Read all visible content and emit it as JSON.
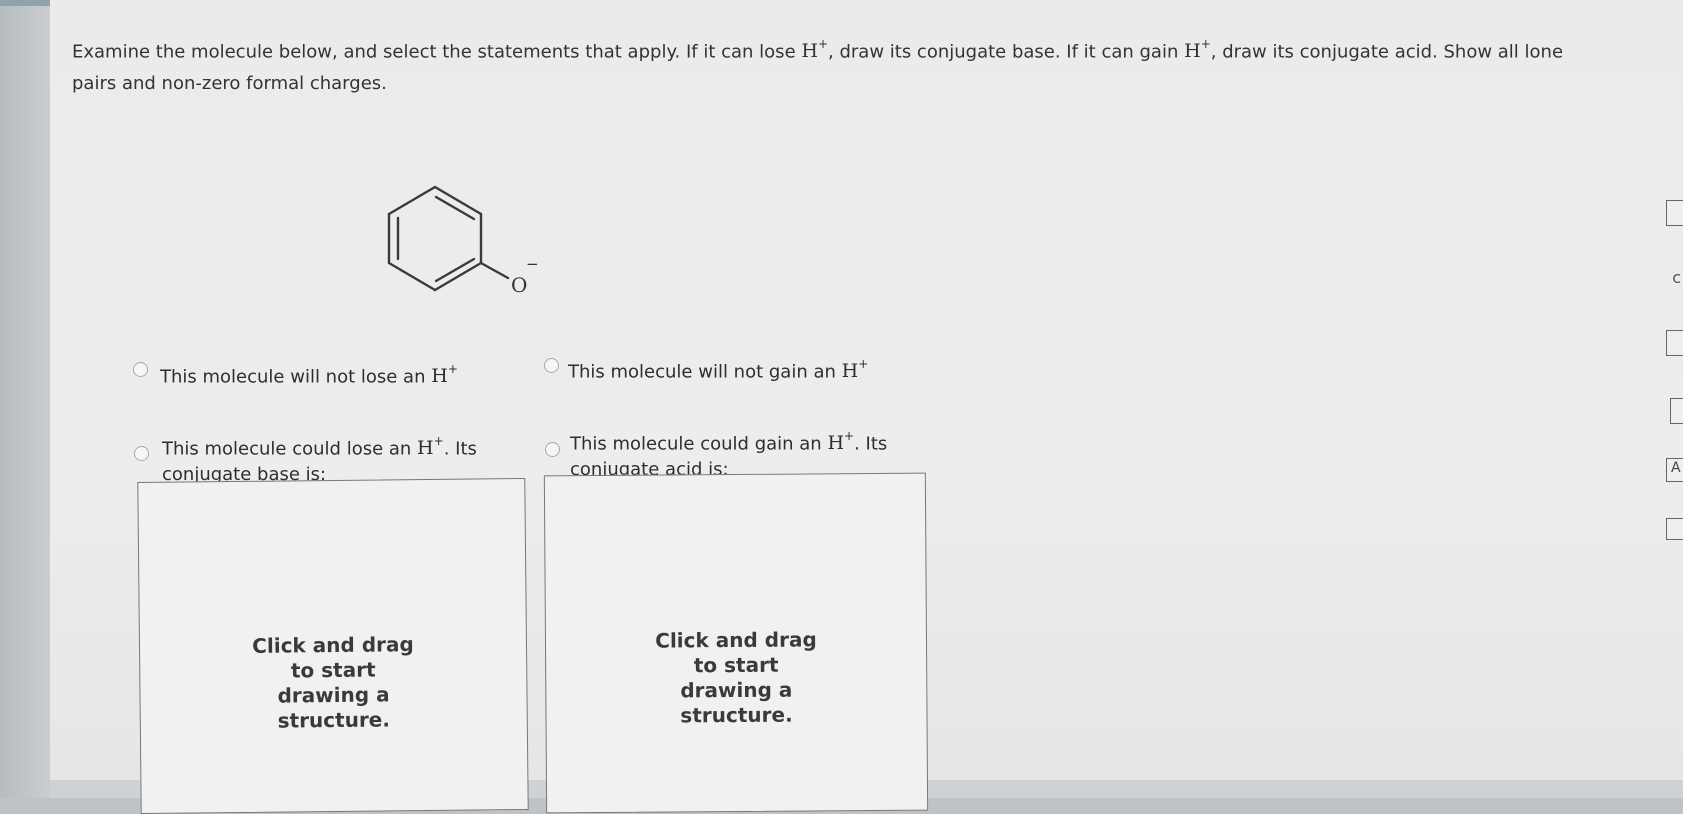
{
  "question": {
    "part1": "Examine the molecule below, and select the statements that apply. If it can lose ",
    "part2": ", draw its conjugate base. If it can gain ",
    "part3": ", draw its conjugate acid. Show all lone pairs and non-zero formal charges.",
    "h_symbol": "H",
    "plus": "+"
  },
  "molecule": {
    "oxygen_label": "O",
    "charge": "−"
  },
  "options": {
    "not_lose": "This molecule will not lose an ",
    "could_lose_a": "This molecule could lose an ",
    "could_lose_b": ". Its",
    "could_lose_c": "conjugate base is:",
    "not_gain": "This molecule will not gain an ",
    "could_gain_a": "This molecule could gain an ",
    "could_gain_b": ". Its",
    "could_gain_c": "conjugate acid is:"
  },
  "drawing_hint": {
    "line1": "Click and drag",
    "line2": "to start",
    "line3": "drawing a",
    "line4": "structure."
  },
  "sidebar": {
    "icon_a": "A",
    "icon_c": "c"
  }
}
